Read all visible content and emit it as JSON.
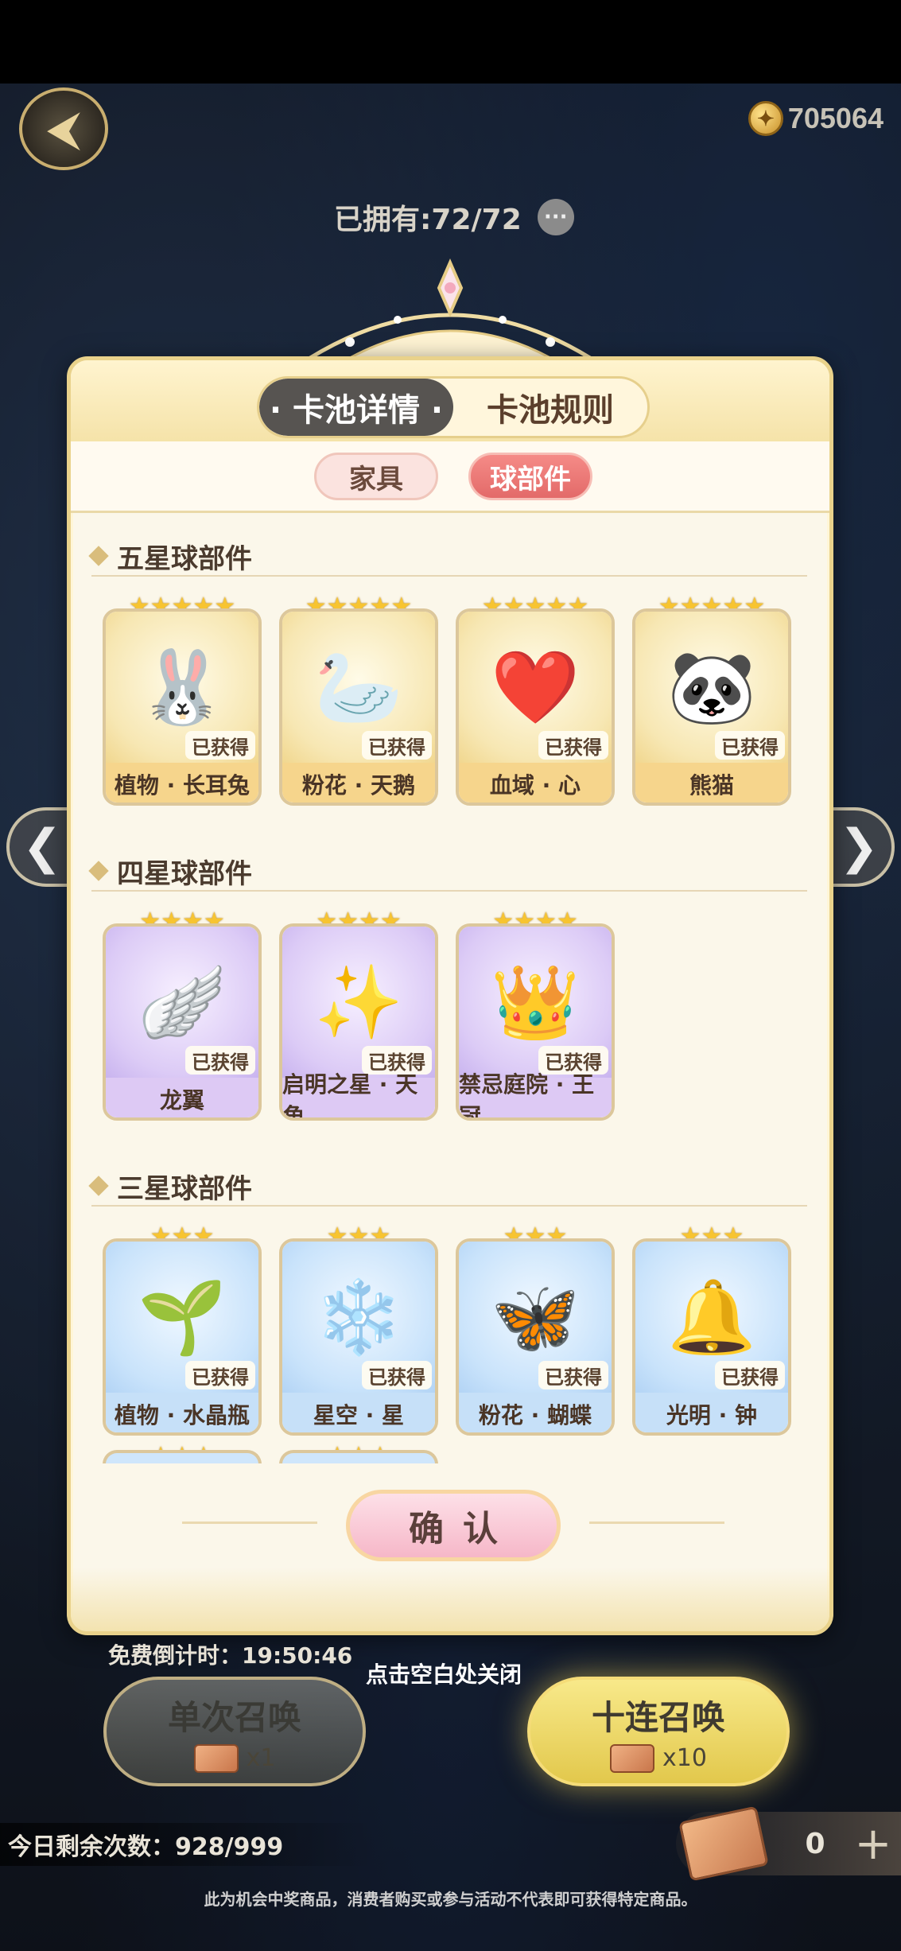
{
  "header": {
    "currency_amount": "705064",
    "owned_text": "已拥有:72/72"
  },
  "modal": {
    "tabs": [
      {
        "label": "· 卡池详情 ·",
        "active": true
      },
      {
        "label": "卡池规则",
        "active": false
      }
    ],
    "sub_tabs": [
      {
        "label": "家具",
        "active": false
      },
      {
        "label": "球部件",
        "active": true
      }
    ],
    "sections": [
      {
        "title": "五星球部件",
        "stars": "★★★★★",
        "items": [
          {
            "name": "植物 · 长耳兔",
            "status": "已获得",
            "icon": "🐰"
          },
          {
            "name": "粉花 · 天鹅",
            "status": "已获得",
            "icon": "🦢"
          },
          {
            "name": "血域 · 心",
            "status": "已获得",
            "icon": "❤️"
          },
          {
            "name": "熊猫",
            "status": "已获得",
            "icon": "🐼"
          }
        ]
      },
      {
        "title": "四星球部件",
        "stars": "★★★★",
        "items": [
          {
            "name": "龙翼",
            "status": "已获得",
            "icon": "🪽"
          },
          {
            "name": "启明之星 · 天角",
            "status": "已获得",
            "icon": "✨"
          },
          {
            "name": "禁忌庭院 · 王冠",
            "status": "已获得",
            "icon": "👑"
          }
        ]
      },
      {
        "title": "三星球部件",
        "stars": "★★★",
        "items": [
          {
            "name": "植物 · 水晶瓶",
            "status": "已获得",
            "icon": "🌱"
          },
          {
            "name": "星空 · 星",
            "status": "已获得",
            "icon": "❄️"
          },
          {
            "name": "粉花 · 蝴蝶",
            "status": "已获得",
            "icon": "🦋"
          },
          {
            "name": "光明 · 钟",
            "status": "已获得",
            "icon": "🔔"
          }
        ]
      }
    ],
    "confirm_label": "确认"
  },
  "footer": {
    "countdown_text": "免费倒计时：19:50:46",
    "close_hint": "点击空白处关闭",
    "single_summon": {
      "label": "单次召唤",
      "cost": "x1"
    },
    "ten_summon": {
      "label": "十连召唤",
      "cost": "x10"
    },
    "remaining_text": "今日剩余次数：928/999",
    "ticket_count": "0",
    "disclaimer": "此为机会中奖商品，消费者购买或参与活动不代表即可获得特定商品。"
  },
  "icons": {
    "back": "back-arrow-icon",
    "coin": "coin-icon",
    "info": "more-icon",
    "prev": "chevron-left-icon",
    "next": "chevron-right-icon",
    "plus": "plus-icon",
    "ticket": "ticket-icon"
  },
  "colors": {
    "active_tab": "#575451",
    "active_subtab": "#e36a69",
    "star": "#f7c431",
    "gold_card": "#f6d58c",
    "purple_card": "#ddc9f4",
    "blue_card": "#c6e0f8"
  }
}
